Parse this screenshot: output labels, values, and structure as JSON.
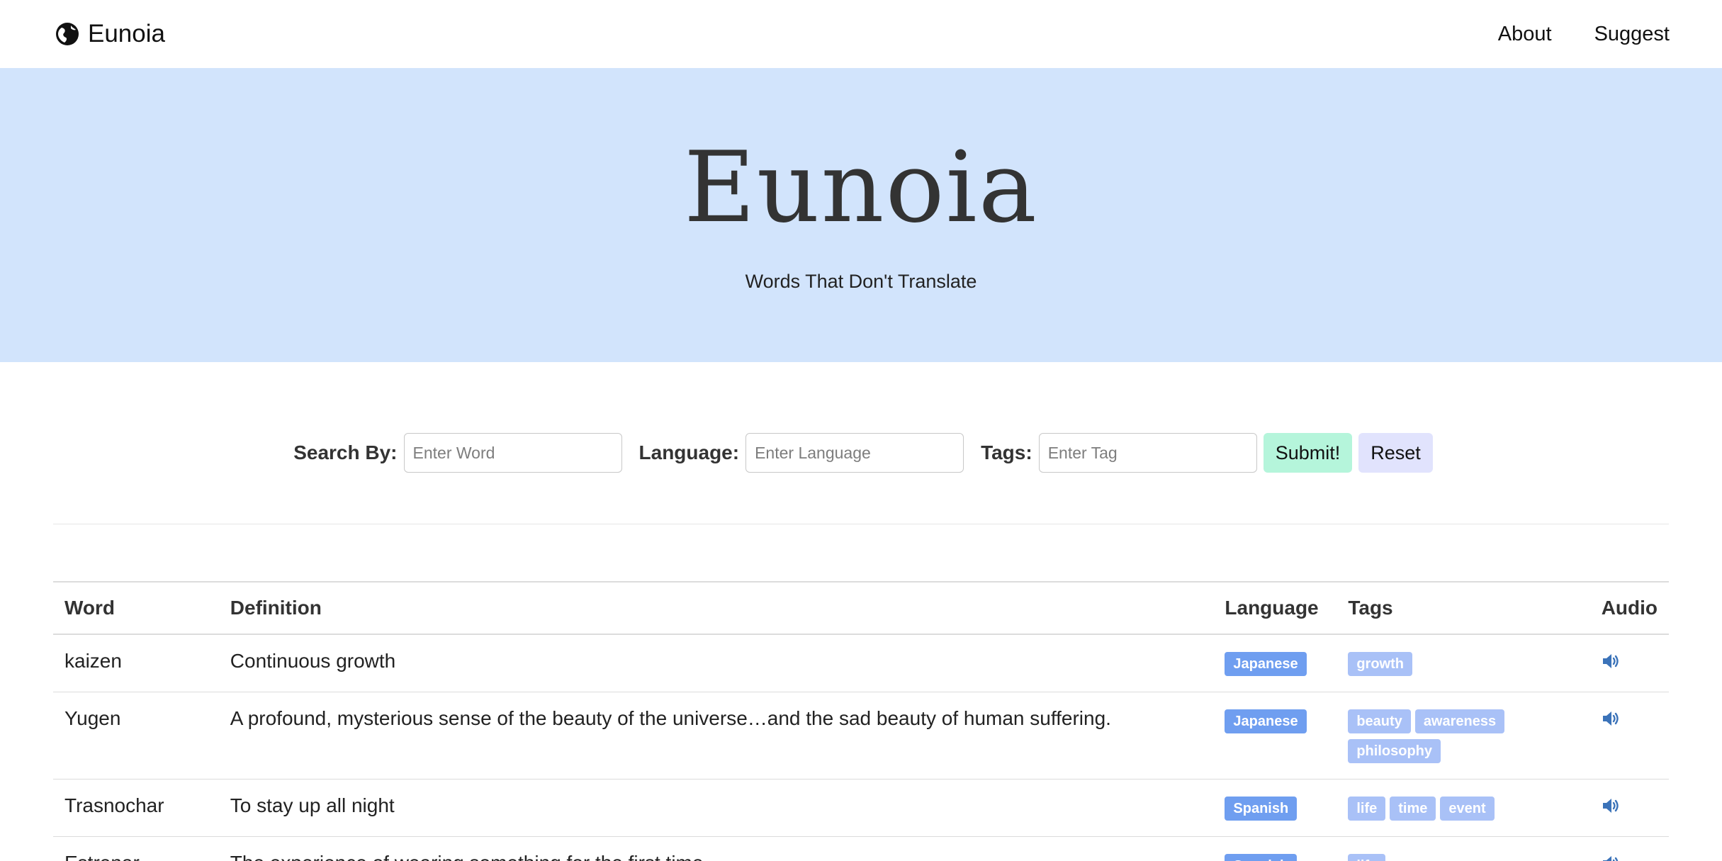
{
  "navbar": {
    "brand_name": "Eunoia",
    "brand_icon": "globe-icon",
    "links": [
      {
        "label": "About"
      },
      {
        "label": "Suggest"
      }
    ]
  },
  "hero": {
    "title": "Eunoia",
    "subtitle": "Words That Don't Translate",
    "background": "#d2e4fc"
  },
  "search": {
    "search_by_label": "Search By:",
    "word_placeholder": "Enter Word",
    "language_label": "Language:",
    "language_placeholder": "Enter Language",
    "tags_label": "Tags:",
    "tags_placeholder": "Enter Tag",
    "submit_label": "Submit!",
    "reset_label": "Reset",
    "submit_color": "#b5f5db",
    "reset_color": "#e1e3fd"
  },
  "table": {
    "headers": [
      "Word",
      "Definition",
      "Language",
      "Tags",
      "Audio"
    ],
    "rows": [
      {
        "word": "kaizen",
        "definition": "Continuous growth",
        "language": "Japanese",
        "tags": [
          "growth"
        ]
      },
      {
        "word": "Yugen",
        "definition": "A profound, mysterious sense of the beauty of the universe…and the sad beauty of human suffering.",
        "language": "Japanese",
        "tags": [
          "beauty",
          "awareness",
          "philosophy"
        ]
      },
      {
        "word": "Trasnochar",
        "definition": "To stay up all night",
        "language": "Spanish",
        "tags": [
          "life",
          "time",
          "event"
        ]
      },
      {
        "word": "Estrenar",
        "definition": "The experience of wearing something for the first time",
        "language": "Spanish",
        "tags": [
          "life"
        ]
      }
    ],
    "audio_icon": "speaker-icon",
    "language_badge_color": "#6f9ef0",
    "tag_badge_color": "#a9c1f7"
  }
}
